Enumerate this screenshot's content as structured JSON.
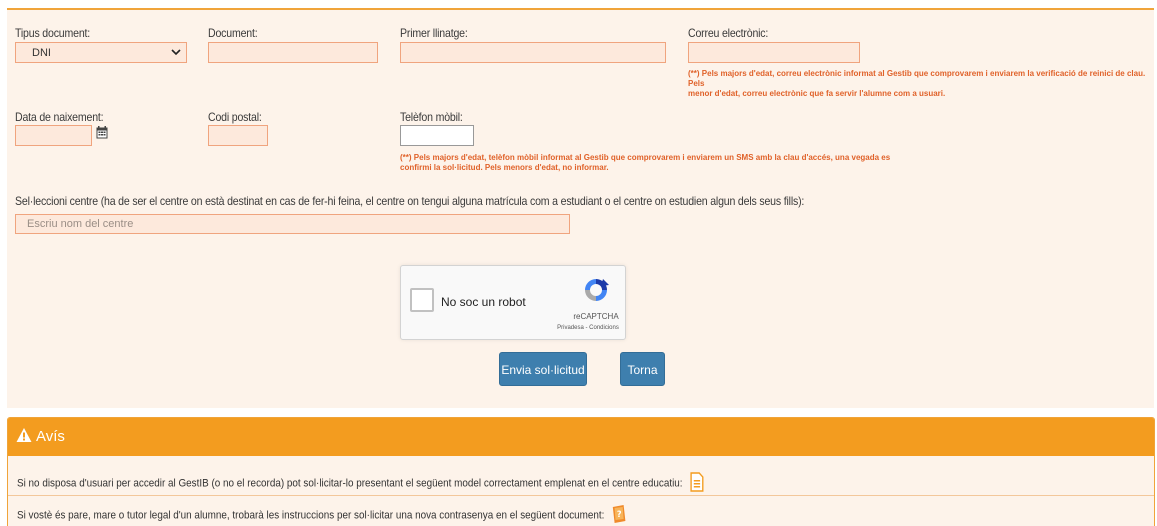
{
  "form": {
    "tipus_document_label": "Tipus document:",
    "tipus_document_value": "DNI",
    "document_label": "Document:",
    "primer_llinatge_label": "Primer llinatge:",
    "correu_label": "Correu electrònic:",
    "correu_note_line1": "(**) Pels majors d'edat, correu electrònic informat al Gestib que comprovarem i enviarem la verificació de reinici de clau. Pels",
    "correu_note_line2": "menor d'edat, correu electrònic que fa servir l'alumne com a usuari.",
    "data_naixement_label": "Data de naixement:",
    "codi_postal_label": "Codi postal:",
    "telefon_label": "Telèfon mòbil:",
    "telefon_note_line1": "(**) Pels majors d'edat, telèfon mòbil informat al Gestib que comprovarem i enviarem un SMS amb la clau d'accés, una vegada es",
    "telefon_note_line2": "confirmi la sol·licitud. Pels menors d'edat, no informar.",
    "centre_label": "Sel·leccioni centre (ha de ser el centre on està destinat en cas de fer-hi feina, el centre on tengui alguna matrícula com a estudiant o el centre on estudien algun dels seus fills):",
    "centre_placeholder": "Escriu nom del centre"
  },
  "recaptcha": {
    "text": "No soc un robot",
    "brand": "reCAPTCHA",
    "links": "Privadesa - Condicions"
  },
  "buttons": {
    "submit": "Envia sol·licitud",
    "back": "Torna"
  },
  "notice": {
    "title": "Avís",
    "line1": "Si no disposa d'usuari per accedir al GestIB (o no el recorda) pot sol·licitar-lo presentant el següent model correctament emplenat en el centre educatiu:",
    "line2": "Si vostè és pare, mare o tutor legal d'un alumne, trobarà les instruccions per sol·licitar una nova contrasenya en el següent document:"
  },
  "icons": {
    "select_chevron": "chevron-down-icon",
    "calendar": "calendar-icon",
    "warning": "warning-icon",
    "document": "document-icon",
    "help_document": "help-document-icon"
  },
  "colors": {
    "accent": "#f39c1f",
    "input_bg": "#fde9dc",
    "input_border": "#f0a47e",
    "button": "#3e7fae",
    "note": "#e0622a"
  }
}
